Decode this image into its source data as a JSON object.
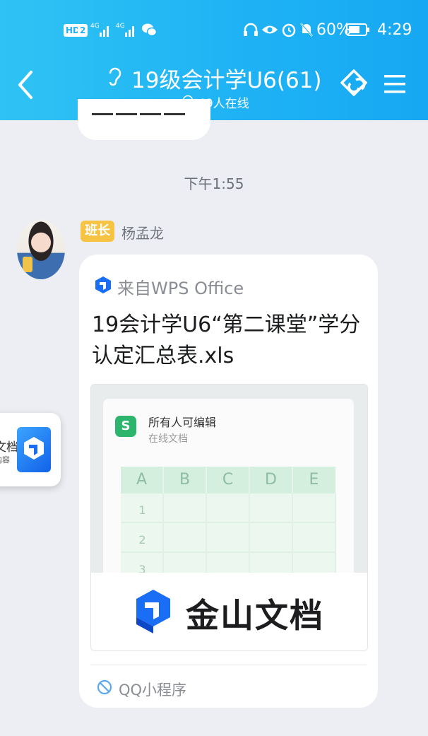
{
  "status_bar": {
    "hd_label": "HD",
    "sim_label": "2",
    "net1": "4G",
    "net2": "4G",
    "battery": "60%",
    "time": "4:29"
  },
  "header": {
    "title": "19级会计学U6(61)",
    "online": "49人在线"
  },
  "prev_message": {},
  "chat": {
    "timestamp": "下午1:55",
    "sender_role": "班长",
    "sender_name": "杨孟龙"
  },
  "card": {
    "source": "来自WPS Office",
    "title": "19会计学U6“第二课堂”学分认定汇总表.xls",
    "preview": {
      "permission": "所有人可编辑",
      "doc_type": "在线文档",
      "columns": [
        "A",
        "B",
        "C",
        "D",
        "E"
      ],
      "rows": [
        "1",
        "2",
        "3"
      ],
      "sheet_icon_letter": "S"
    },
    "brand": "金山文档",
    "footer": "QQ小程序"
  },
  "floating_tab": {
    "line1": "文档",
    "line2": "内容"
  },
  "colors": {
    "header": "#1fb3f5",
    "role_badge": "#f7c342",
    "sheet_green": "#2db56d",
    "wps_blue": "#1a6ef5"
  }
}
